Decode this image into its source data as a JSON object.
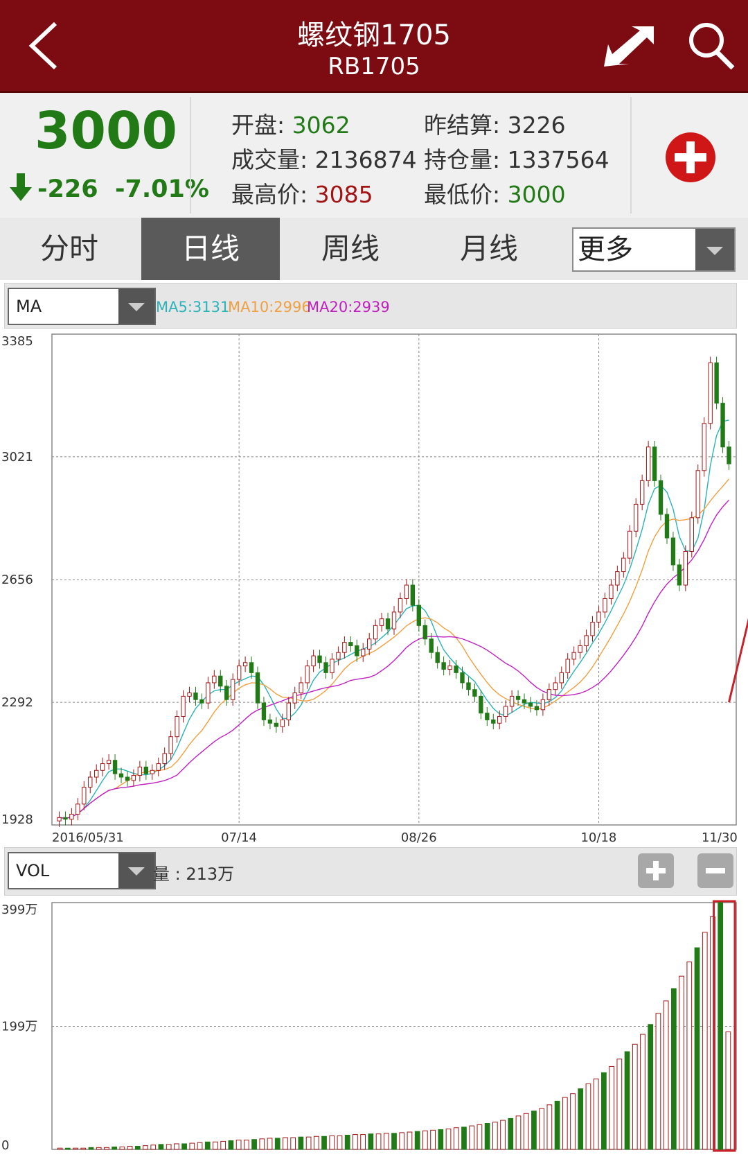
{
  "header": {
    "title": "螺纹钢1705",
    "subtitle": "RB1705"
  },
  "quote": {
    "price": "3000",
    "change": "-226",
    "change_pct": "-7.01%",
    "open_label": "开盘:",
    "open": "3062",
    "prev_settle_label": "昨结算:",
    "prev_settle": "3226",
    "volume_label": "成交量:",
    "volume": "2136874",
    "open_interest_label": "持仓量:",
    "open_interest": "1337564",
    "high_label": "最高价:",
    "high": "3085",
    "low_label": "最低价:",
    "low": "3000"
  },
  "tabs": [
    "分时",
    "日线",
    "周线",
    "月线"
  ],
  "active_tab": "日线",
  "more_select": "更多",
  "indicator": {
    "selected": "MA",
    "ma5": "MA5:3131",
    "ma10": "MA10:2996",
    "ma20": "MA20:2939",
    "ma5_color": "#2ab3b8",
    "ma10_color": "#f0a040",
    "ma20_color": "#c020c0"
  },
  "volume_panel": {
    "selected": "VOL",
    "label": "量 : 213万"
  },
  "colors": {
    "header_bg": "#7d0c12",
    "up": "#a31515",
    "down": "#217a16"
  },
  "chart_data": [
    {
      "type": "candlestick",
      "y_ticks": [
        "3385",
        "3021",
        "2656",
        "2292",
        "1928"
      ],
      "ylim": [
        1928,
        3385
      ],
      "x_ticks": [
        "2016/05/31",
        "07/14",
        "08/26",
        "10/18",
        "11/30"
      ],
      "grid": true,
      "close_series": [
        1950,
        1945,
        1960,
        1990,
        2040,
        2070,
        2090,
        2110,
        2120,
        2080,
        2070,
        2060,
        2075,
        2100,
        2080,
        2090,
        2110,
        2140,
        2190,
        2250,
        2310,
        2320,
        2300,
        2290,
        2350,
        2370,
        2340,
        2300,
        2360,
        2400,
        2410,
        2380,
        2290,
        2240,
        2230,
        2220,
        2240,
        2290,
        2320,
        2350,
        2400,
        2430,
        2410,
        2380,
        2420,
        2440,
        2470,
        2460,
        2430,
        2450,
        2480,
        2520,
        2540,
        2510,
        2560,
        2600,
        2640,
        2580,
        2520,
        2480,
        2440,
        2410,
        2390,
        2400,
        2380,
        2350,
        2330,
        2310,
        2260,
        2240,
        2230,
        2250,
        2280,
        2310,
        2300,
        2290,
        2280,
        2270,
        2300,
        2330,
        2350,
        2380,
        2420,
        2440,
        2460,
        2490,
        2530,
        2560,
        2600,
        2640,
        2680,
        2720,
        2800,
        2880,
        2950,
        3050,
        2950,
        2850,
        2780,
        2700,
        2640,
        2740,
        2840,
        2980,
        3120,
        3300,
        3180,
        3050,
        3000
      ],
      "trend_line": [
        [
          108,
          2292
        ],
        [
          121,
          3295
        ],
        [
          124,
          2730
        ],
        [
          128,
          3380
        ],
        [
          131,
          3030
        ]
      ],
      "ma_lines": [
        "MA5",
        "MA10",
        "MA20"
      ]
    },
    {
      "type": "bar",
      "name": "VOL",
      "y_ticks": [
        "399万",
        "199万",
        "0"
      ],
      "ylim": [
        0,
        399
      ],
      "values": [
        2,
        2,
        2,
        2,
        3,
        3,
        3,
        4,
        4,
        5,
        5,
        6,
        7,
        8,
        8,
        9,
        9,
        10,
        11,
        12,
        12,
        13,
        14,
        15,
        15,
        16,
        17,
        18,
        18,
        19,
        19,
        20,
        20,
        21,
        21,
        22,
        22,
        23,
        24,
        24,
        25,
        25,
        26,
        26,
        27,
        28,
        29,
        30,
        31,
        32,
        33,
        35,
        36,
        38,
        40,
        42,
        44,
        47,
        50,
        54,
        58,
        62,
        66,
        72,
        78,
        84,
        90,
        98,
        106,
        114,
        124,
        134,
        146,
        158,
        170,
        186,
        202,
        220,
        240,
        260,
        280,
        303,
        326,
        351,
        376,
        399,
        190
      ]
    }
  ]
}
